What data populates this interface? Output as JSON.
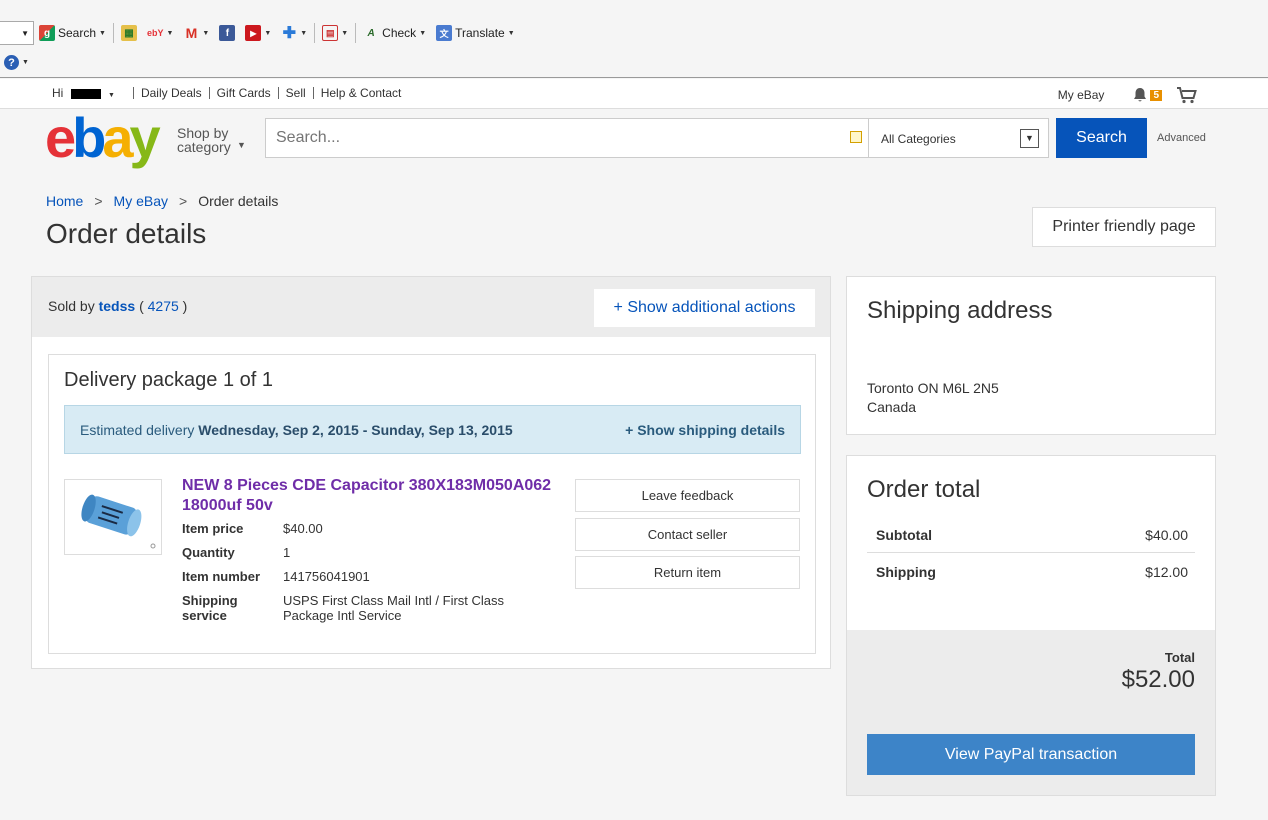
{
  "toolbar": {
    "search_label": "Search",
    "check_label": "Check",
    "translate_label": "Translate",
    "ebay_icon_label": "ebY"
  },
  "topnav": {
    "greeting": "Hi",
    "links": [
      "Daily Deals",
      "Gift Cards",
      "Sell",
      "Help & Contact"
    ],
    "my_ebay": "My eBay",
    "notification_count": "5"
  },
  "header": {
    "logo": [
      "e",
      "b",
      "a",
      "y"
    ],
    "shop_by": "Shop by",
    "category": "category",
    "search_placeholder": "Search...",
    "category_select": "All Categories",
    "search_button": "Search",
    "advanced": "Advanced"
  },
  "breadcrumb": {
    "home": "Home",
    "my_ebay": "My eBay",
    "current": "Order details",
    "separator": ">"
  },
  "page": {
    "title": "Order details",
    "printer_button": "Printer friendly page"
  },
  "seller": {
    "sold_by": "Sold by",
    "name": "tedss",
    "feedback_open": "(",
    "feedback": "4275",
    "feedback_close": ")",
    "additional_actions": "+ Show additional actions"
  },
  "package": {
    "title": "Delivery package 1 of 1",
    "estimated_label": "Estimated delivery",
    "estimated_dates": "Wednesday, Sep 2, 2015 - Sunday, Sep 13, 2015",
    "show_shipping": "+ Show shipping details"
  },
  "item": {
    "title": "NEW 8 Pieces CDE Capacitor 380X183M050A062 18000uf 50v",
    "specs": [
      {
        "label": "Item price",
        "value": "$40.00"
      },
      {
        "label": "Quantity",
        "value": "1"
      },
      {
        "label": "Item number",
        "value": "141756041901"
      },
      {
        "label": "Shipping service",
        "value": "USPS First Class Mail Intl / First Class Package Intl Service"
      }
    ],
    "actions": [
      "Leave feedback",
      "Contact seller",
      "Return item"
    ]
  },
  "shipping_address": {
    "title": "Shipping address",
    "line1": "Toronto ON M6L 2N5",
    "line2": "Canada"
  },
  "order_total": {
    "title": "Order total",
    "subtotal_label": "Subtotal",
    "subtotal": "$40.00",
    "shipping_label": "Shipping",
    "shipping": "$12.00",
    "total_label": "Total",
    "total": "$52.00",
    "paypal_button": "View PayPal transaction"
  },
  "colors": {
    "link_blue": "#0654ba",
    "item_purple": "#6f2da8",
    "paypal_blue": "#3d84c8"
  }
}
